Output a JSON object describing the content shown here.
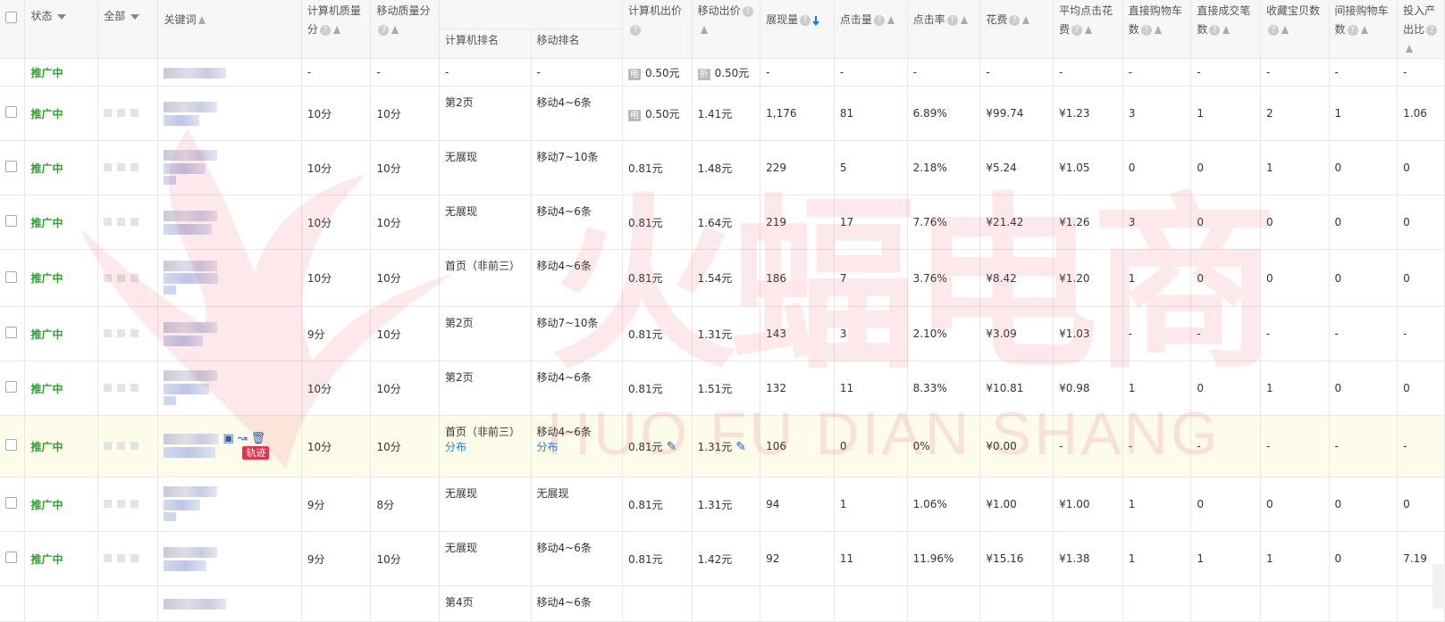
{
  "header": {
    "status": "状态",
    "scope": "全部",
    "keyword": "关键词",
    "pc_quality": "计算机质量分",
    "mobile_quality": "移动质量分",
    "pc_rank": "计算机排名",
    "mobile_rank": "移动排名",
    "pc_bid": "计算机出价",
    "mobile_bid": "移动出价",
    "impressions": "展现量",
    "clicks": "点击量",
    "ctr": "点击率",
    "cost": "花费",
    "avg_cpc": "平均点击花费",
    "direct_cart": "直接购物车数",
    "direct_deals": "直接成交笔数",
    "fav_items": "收藏宝贝数",
    "indirect_cart": "间接购物车数",
    "roi": "投入产出比"
  },
  "icons": {
    "pc_tag": "电",
    "mobile_tag": "折",
    "track": "轨迹",
    "help": "?"
  },
  "default_row": {
    "status": "推广中",
    "pc_quality": "-",
    "mobile_quality": "-",
    "pc_rank": "-",
    "mobile_rank": "-",
    "pc_bid": "0.50元",
    "mobile_bid": "0.50元",
    "impressions": "-",
    "clicks": "-",
    "ctr": "-",
    "cost": "-",
    "avg_cpc": "-",
    "direct_cart": "-",
    "direct_deals": "-",
    "fav_items": "-",
    "indirect_cart": "-",
    "roi": "-"
  },
  "rows": [
    {
      "status": "推广中",
      "pc_quality": "10分",
      "mobile_quality": "10分",
      "pc_rank": "第2页",
      "mobile_rank": "移动4~6条",
      "pc_bid": "0.50元",
      "mobile_bid": "1.41元",
      "impressions": "1,176",
      "clicks": "81",
      "ctr": "6.89%",
      "cost": "¥99.74",
      "avg_cpc": "¥1.23",
      "direct_cart": "3",
      "direct_deals": "1",
      "fav_items": "2",
      "indirect_cart": "1",
      "roi": "1.06"
    },
    {
      "status": "推广中",
      "pc_quality": "10分",
      "mobile_quality": "10分",
      "pc_rank": "无展现",
      "mobile_rank": "移动7~10条",
      "pc_bid": "0.81元",
      "mobile_bid": "1.48元",
      "impressions": "229",
      "clicks": "5",
      "ctr": "2.18%",
      "cost": "¥5.24",
      "avg_cpc": "¥1.05",
      "direct_cart": "0",
      "direct_deals": "0",
      "fav_items": "1",
      "indirect_cart": "0",
      "roi": "0"
    },
    {
      "status": "推广中",
      "pc_quality": "10分",
      "mobile_quality": "10分",
      "pc_rank": "无展现",
      "mobile_rank": "移动4~6条",
      "pc_bid": "0.81元",
      "mobile_bid": "1.64元",
      "impressions": "219",
      "clicks": "17",
      "ctr": "7.76%",
      "cost": "¥21.42",
      "avg_cpc": "¥1.26",
      "direct_cart": "3",
      "direct_deals": "0",
      "fav_items": "0",
      "indirect_cart": "0",
      "roi": "0"
    },
    {
      "status": "推广中",
      "pc_quality": "10分",
      "mobile_quality": "10分",
      "pc_rank": "首页（非前三）",
      "mobile_rank": "移动4~6条",
      "pc_bid": "0.81元",
      "mobile_bid": "1.54元",
      "impressions": "186",
      "clicks": "7",
      "ctr": "3.76%",
      "cost": "¥8.42",
      "avg_cpc": "¥1.20",
      "direct_cart": "1",
      "direct_deals": "0",
      "fav_items": "0",
      "indirect_cart": "0",
      "roi": "0"
    },
    {
      "status": "推广中",
      "pc_quality": "9分",
      "mobile_quality": "10分",
      "pc_rank": "第2页",
      "mobile_rank": "移动7~10条",
      "pc_bid": "0.81元",
      "mobile_bid": "1.31元",
      "impressions": "143",
      "clicks": "3",
      "ctr": "2.10%",
      "cost": "¥3.09",
      "avg_cpc": "¥1.03",
      "direct_cart": "-",
      "direct_deals": "-",
      "fav_items": "-",
      "indirect_cart": "-",
      "roi": "-"
    },
    {
      "status": "推广中",
      "pc_quality": "10分",
      "mobile_quality": "10分",
      "pc_rank": "第2页",
      "mobile_rank": "移动4~6条",
      "pc_bid": "0.81元",
      "mobile_bid": "1.51元",
      "impressions": "132",
      "clicks": "11",
      "ctr": "8.33%",
      "cost": "¥10.81",
      "avg_cpc": "¥0.98",
      "direct_cart": "1",
      "direct_deals": "0",
      "fav_items": "1",
      "indirect_cart": "0",
      "roi": "0"
    },
    {
      "status": "推广中",
      "pc_quality": "10分",
      "mobile_quality": "10分",
      "pc_rank": "首页（非前三）",
      "pc_rank_link": "分布",
      "mobile_rank": "移动4~6条",
      "mobile_rank_link": "分布",
      "pc_bid": "0.81元",
      "mobile_bid": "1.31元",
      "impressions": "106",
      "clicks": "0",
      "ctr": "0%",
      "cost": "¥0.00",
      "avg_cpc": "-",
      "direct_cart": "-",
      "direct_deals": "-",
      "fav_items": "-",
      "indirect_cart": "-",
      "roi": "-"
    },
    {
      "status": "推广中",
      "pc_quality": "9分",
      "mobile_quality": "8分",
      "pc_rank": "无展现",
      "mobile_rank": "无展现",
      "pc_bid": "0.81元",
      "mobile_bid": "1.31元",
      "impressions": "94",
      "clicks": "1",
      "ctr": "1.06%",
      "cost": "¥1.00",
      "avg_cpc": "¥1.00",
      "direct_cart": "1",
      "direct_deals": "0",
      "fav_items": "0",
      "indirect_cart": "0",
      "roi": "0"
    },
    {
      "status": "推广中",
      "pc_quality": "9分",
      "mobile_quality": "10分",
      "pc_rank": "无展现",
      "mobile_rank": "移动4~6条",
      "pc_bid": "0.81元",
      "mobile_bid": "1.42元",
      "impressions": "92",
      "clicks": "11",
      "ctr": "11.96%",
      "cost": "¥15.16",
      "avg_cpc": "¥1.38",
      "direct_cart": "1",
      "direct_deals": "1",
      "fav_items": "1",
      "indirect_cart": "0",
      "roi": "7.19"
    },
    {
      "pc_rank": "第4页",
      "mobile_rank": "移动4~6条"
    }
  ],
  "watermark": {
    "cn": "火蝠电商",
    "en": "HUO FU DIAN SHANG"
  }
}
